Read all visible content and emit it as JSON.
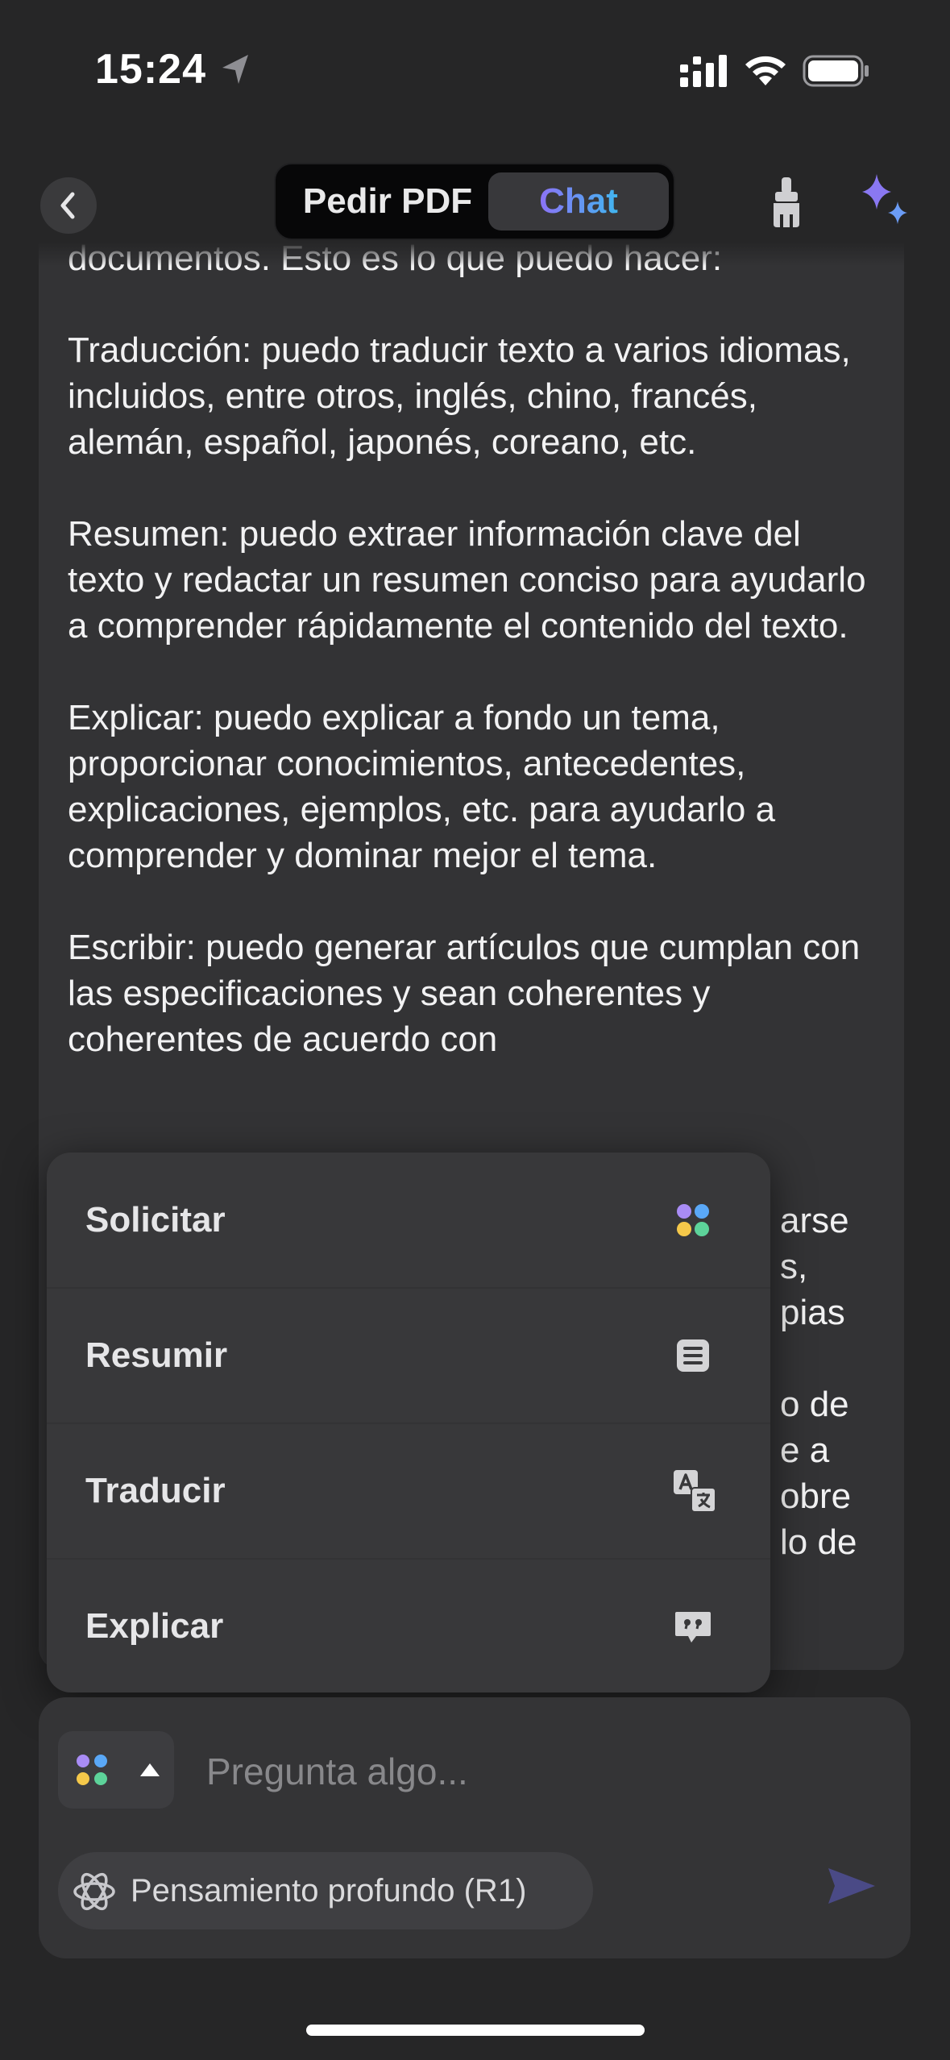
{
  "status_bar": {
    "time": "15:24"
  },
  "nav": {
    "tab_pdf": "Pedir PDF",
    "tab_chat": "Chat",
    "active_tab": "Chat",
    "accent_gradient": [
      "#8c72f6",
      "#41b6f0"
    ]
  },
  "chat": {
    "paragraphs": [
      "documentos. Esto es lo que puedo hacer:",
      "Traducción: puedo traducir texto a varios idiomas, incluidos, entre otros, inglés, chino, francés, alemán, español, japonés, coreano, etc.",
      "Resumen: puedo extraer información clave del texto y redactar un resumen conciso para ayudarlo a comprender rápidamente el contenido del texto.",
      "Explicar: puedo explicar a fondo un tema, proporcionar conocimientos, antecedentes, explicaciones, ejemplos, etc. para ayudarlo a comprender y dominar mejor el tema.",
      "Escribir: puedo generar artículos que cumplan con las especificaciones y sean coherentes y coherentes de acuerdo con"
    ],
    "hidden_fragments": [
      "arse",
      "s,",
      "pias",
      "o de",
      "e a",
      "obre",
      "lo de"
    ]
  },
  "menu": {
    "items": [
      {
        "label": "Solicitar",
        "icon": "apps-dots-icon"
      },
      {
        "label": "Resumir",
        "icon": "list-document-icon"
      },
      {
        "label": "Traducir",
        "icon": "translate-icon"
      },
      {
        "label": "Explicar",
        "icon": "quote-bubble-icon"
      }
    ]
  },
  "composer": {
    "placeholder": "Pregunta algo...",
    "value": "",
    "deep_think_label": "Pensamiento profundo (R1)",
    "send_color": "#4a4a86"
  },
  "colors": {
    "background": "#262627",
    "bubble": "#333335",
    "menu": "#38383a",
    "dot_purple": "#a98cf5",
    "dot_blue": "#5aa8f7",
    "dot_yellow": "#f5c84a",
    "dot_green": "#5dd39a"
  }
}
